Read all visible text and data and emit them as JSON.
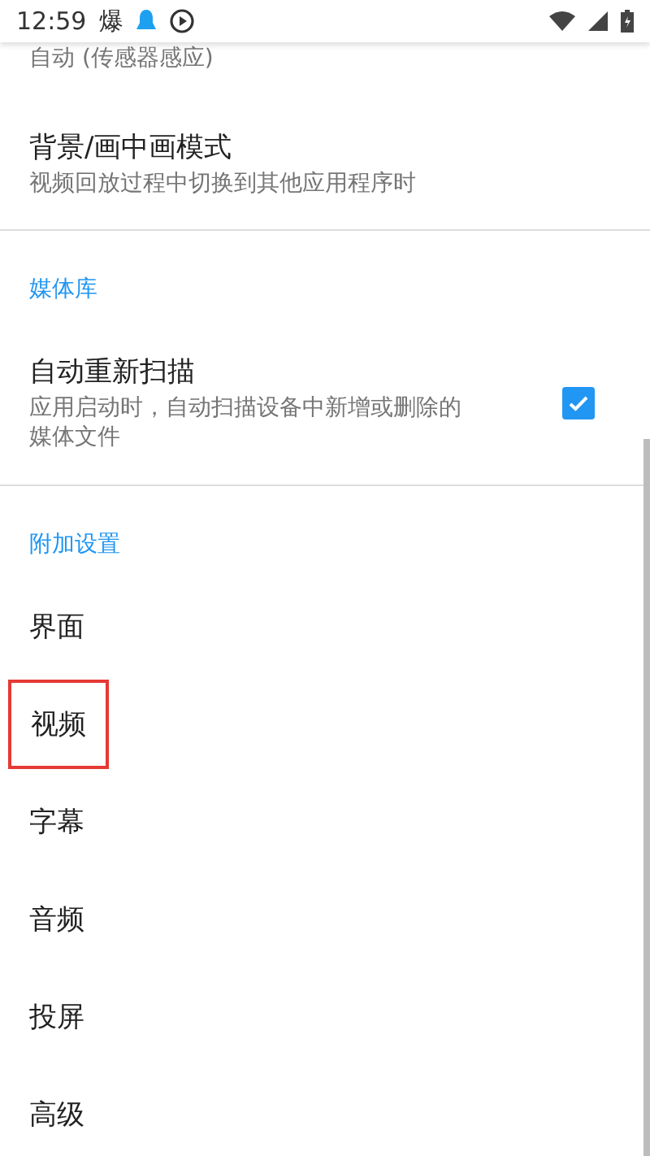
{
  "status_bar": {
    "time": "12:59",
    "app_glyph": "爆"
  },
  "top_summary": "自动 (传感器感应)",
  "background_pref": {
    "title": "背景/画中画模式",
    "summary": "视频回放过程中切换到其他应用程序时"
  },
  "media_section": {
    "header": "媒体库",
    "items": [
      {
        "kind": "checkbox",
        "title": "自动重新扫描",
        "summary": "应用启动时，自动扫描设备中新增或删除的媒体文件",
        "checked": true
      }
    ]
  },
  "extra_section": {
    "header": "附加设置",
    "items": [
      {
        "kind": "simple",
        "title": "界面",
        "highlighted": false
      },
      {
        "kind": "simple",
        "title": "视频",
        "highlighted": true
      },
      {
        "kind": "simple",
        "title": "字幕",
        "highlighted": false
      },
      {
        "kind": "simple",
        "title": "音频",
        "highlighted": false
      },
      {
        "kind": "simple",
        "title": "投屏",
        "highlighted": false
      },
      {
        "kind": "simple",
        "title": "高级",
        "highlighted": false
      }
    ]
  }
}
